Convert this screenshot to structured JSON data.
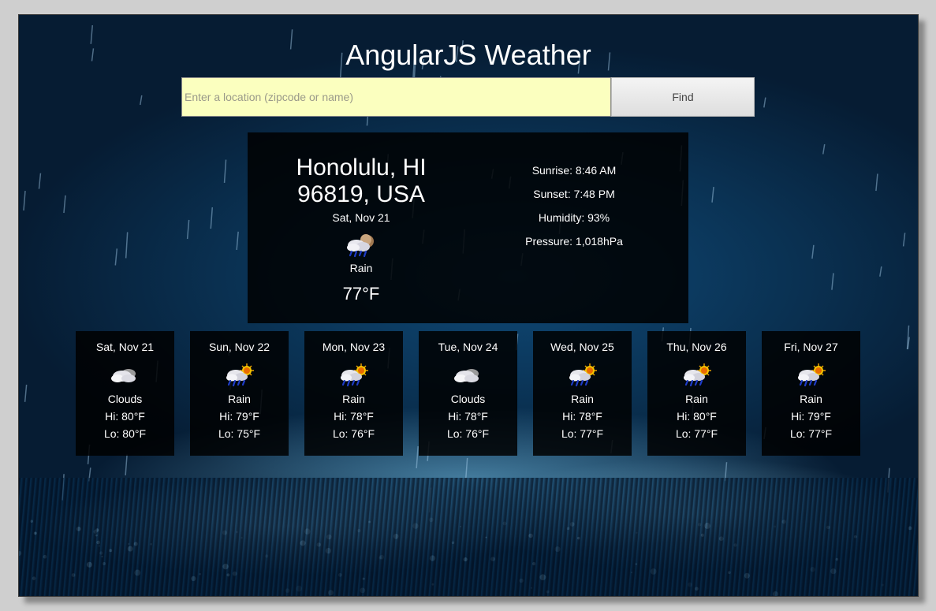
{
  "app": {
    "title": "AngularJS Weather"
  },
  "search": {
    "placeholder": "Enter a location (zipcode or name)",
    "value": "",
    "button_label": "Find"
  },
  "current": {
    "city_line1": "Honolulu, HI",
    "city_line2": "96819, USA",
    "date": "Sat, Nov 21",
    "icon": "rain-icon",
    "condition": "Rain",
    "temperature": "77°F",
    "sunrise": "Sunrise: 8:46 AM",
    "sunset": "Sunset: 7:48 PM",
    "humidity": "Humidity: 93%",
    "pressure": "Pressure: 1,018hPa"
  },
  "forecast": [
    {
      "date": "Sat, Nov 21",
      "icon": "clouds-icon",
      "condition": "Clouds",
      "hi": "Hi: 80°F",
      "lo": "Lo: 80°F"
    },
    {
      "date": "Sun, Nov 22",
      "icon": "rain-sun-icon",
      "condition": "Rain",
      "hi": "Hi: 79°F",
      "lo": "Lo: 75°F"
    },
    {
      "date": "Mon, Nov 23",
      "icon": "rain-sun-icon",
      "condition": "Rain",
      "hi": "Hi: 78°F",
      "lo": "Lo: 76°F"
    },
    {
      "date": "Tue, Nov 24",
      "icon": "clouds-icon",
      "condition": "Clouds",
      "hi": "Hi: 78°F",
      "lo": "Lo: 76°F"
    },
    {
      "date": "Wed, Nov 25",
      "icon": "rain-sun-icon",
      "condition": "Rain",
      "hi": "Hi: 78°F",
      "lo": "Lo: 77°F"
    },
    {
      "date": "Thu, Nov 26",
      "icon": "rain-sun-icon",
      "condition": "Rain",
      "hi": "Hi: 80°F",
      "lo": "Lo: 77°F"
    },
    {
      "date": "Fri, Nov 27",
      "icon": "rain-sun-icon",
      "condition": "Rain",
      "hi": "Hi: 79°F",
      "lo": "Lo: 77°F"
    }
  ],
  "colors": {
    "input_background": "#fbffbf",
    "panel_background": "#000000",
    "text": "#ffffff"
  }
}
